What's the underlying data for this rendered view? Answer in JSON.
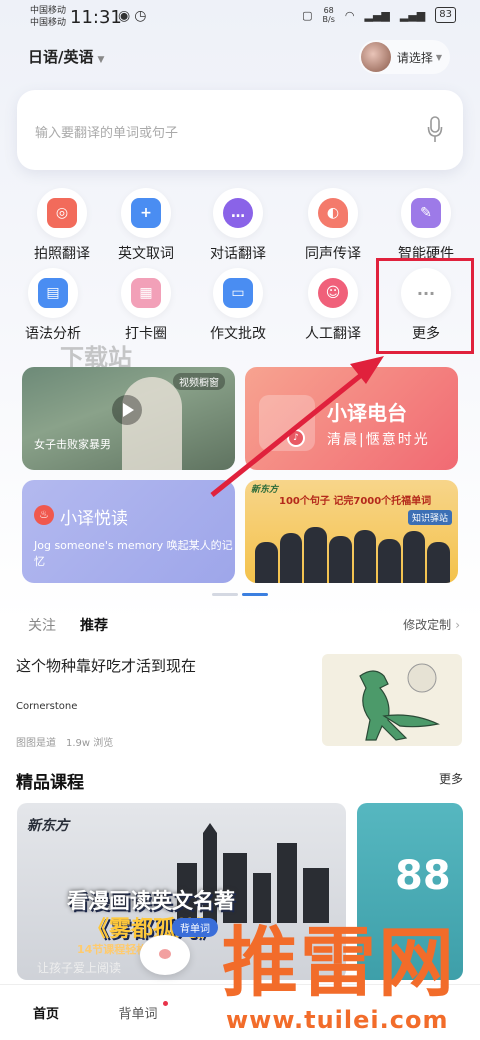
{
  "status_bar": {
    "carrier_1": "中国移动",
    "carrier_2": "中国移动",
    "time": "11:31",
    "net_speed_value": "68",
    "net_speed_unit": "B/s",
    "battery": "83"
  },
  "header": {
    "language": "日语/英语",
    "profile_label": "请选择"
  },
  "search": {
    "placeholder": "输入要翻译的单词或句子"
  },
  "features": [
    {
      "label": "拍照翻译",
      "icon": "camera-translate-icon",
      "color": "#f26b5b"
    },
    {
      "label": "英文取词",
      "icon": "word-pick-icon",
      "color": "#4a8df2"
    },
    {
      "label": "对话翻译",
      "icon": "dialogue-icon",
      "color": "#8a63e8"
    },
    {
      "label": "同声传译",
      "icon": "simultaneous-icon",
      "color": "#f47a6b"
    },
    {
      "label": "智能硬件",
      "icon": "hardware-icon",
      "color": "#9d7ae8"
    },
    {
      "label": "语法分析",
      "icon": "grammar-icon",
      "color": "#4a8df2"
    },
    {
      "label": "打卡圈",
      "icon": "checkin-icon",
      "color": "#f2a0b8"
    },
    {
      "label": "作文批改",
      "icon": "essay-icon",
      "color": "#4a8df2"
    },
    {
      "label": "人工翻译",
      "icon": "human-translate-icon",
      "color": "#f0607a"
    },
    {
      "label": "更多",
      "icon": "more-icon",
      "color": "#bbbbbb"
    }
  ],
  "watermark_top": "下载站",
  "cards": {
    "video": {
      "tag": "视频橱窗",
      "caption": "女子击败家暴男"
    },
    "radio": {
      "title": "小译电台",
      "subtitle": "清晨|惬意时光"
    },
    "reading": {
      "title": "小译悦读",
      "text": "Jog someone's memory 唤起某人的记忆"
    },
    "banner": {
      "brand": "新东方",
      "headline": "100个句子 记完7000个托福单词",
      "tag": "知识驿站"
    }
  },
  "feed": {
    "tabs": [
      "关注",
      "推荐"
    ],
    "active_tab": "推荐",
    "customize": "修改定制"
  },
  "article": {
    "title": "这个物种靠好吃才活到现在",
    "source": "Cornerstone",
    "publisher": "图图是道",
    "views": "1.9w 浏览"
  },
  "courses": {
    "section_title": "精品课程",
    "more": "更多",
    "items": [
      {
        "brand": "新东方",
        "title": "看漫画读英文名著",
        "title_line2": "《雾都孤儿》",
        "sub": "14节课程轻松读懂",
        "sub2": "让孩子爱上阅读"
      },
      {
        "title": "88"
      }
    ],
    "mascot_bubble": "背单词"
  },
  "bottom_nav": {
    "items": [
      "首页",
      "背单词"
    ]
  },
  "watermark": {
    "logo": "推雷网",
    "url": "www.tuilei.com"
  },
  "colors": {
    "accent": "#3b7fe0",
    "highlight": "#e0213c",
    "watermark": "#f26c2a"
  }
}
